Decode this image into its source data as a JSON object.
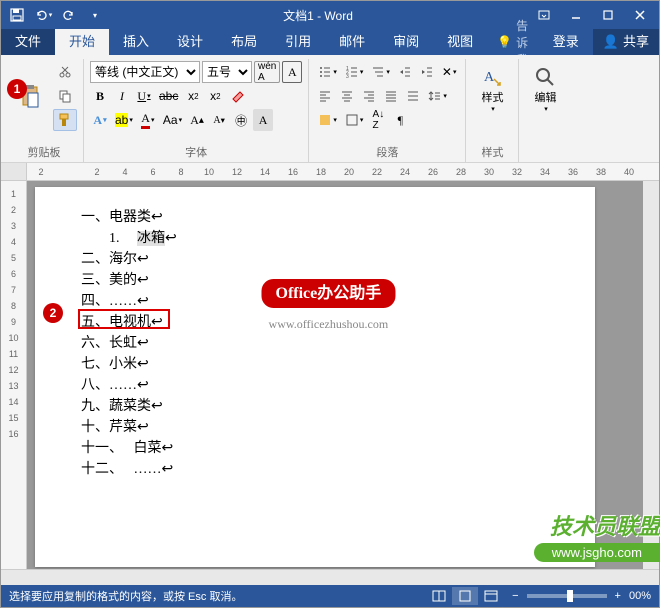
{
  "title": "文档1 - Word",
  "tabs": {
    "file": "文件",
    "home": "开始",
    "insert": "插入",
    "design": "设计",
    "layout": "布局",
    "references": "引用",
    "mailings": "邮件",
    "review": "审阅",
    "view": "视图",
    "tellme": "告诉我...",
    "signin": "登录",
    "share": "共享"
  },
  "ribbon": {
    "clipboard": {
      "label": "剪贴板",
      "paste": "粘贴"
    },
    "font": {
      "label": "字体",
      "name": "等线 (中文正文)",
      "size": "五号",
      "bold": "B",
      "italic": "I",
      "underline": "U"
    },
    "paragraph": {
      "label": "段落"
    },
    "styles": {
      "label": "样式",
      "btn": "样式"
    },
    "editing": {
      "label": "编辑",
      "btn": "编辑"
    }
  },
  "badges": {
    "one": "1",
    "two": "2"
  },
  "doc": {
    "lines": [
      "一、电器类↩",
      "        1.     冰箱↩",
      "二、海尔↩",
      "三、美的↩",
      "四、……↩",
      "五、电视机↩",
      "六、长虹↩",
      "七、小米↩",
      "八、……↩",
      "九、蔬菜类↩",
      "十、芹菜↩",
      "十一、   白菜↩",
      "十二、   ……↩"
    ]
  },
  "watermark": {
    "title": "Office办公助手",
    "url": "www.officezhushou.com"
  },
  "logo": {
    "text1": "技术员联盟",
    "text2": "www.jsgho.com"
  },
  "status": {
    "text": "选择要应用复制的格式的内容，或按 Esc 取消。",
    "zoom": "00%"
  },
  "ruler_h": [
    "2",
    "",
    "2",
    "4",
    "6",
    "8",
    "10",
    "12",
    "14",
    "16",
    "18",
    "20",
    "22",
    "24",
    "26",
    "28",
    "30",
    "32",
    "34",
    "36",
    "38",
    "40"
  ],
  "ruler_v": [
    "",
    "1",
    "2",
    "3",
    "4",
    "5",
    "6",
    "7",
    "8",
    "9",
    "10",
    "11",
    "12",
    "13",
    "14",
    "15",
    "16"
  ]
}
